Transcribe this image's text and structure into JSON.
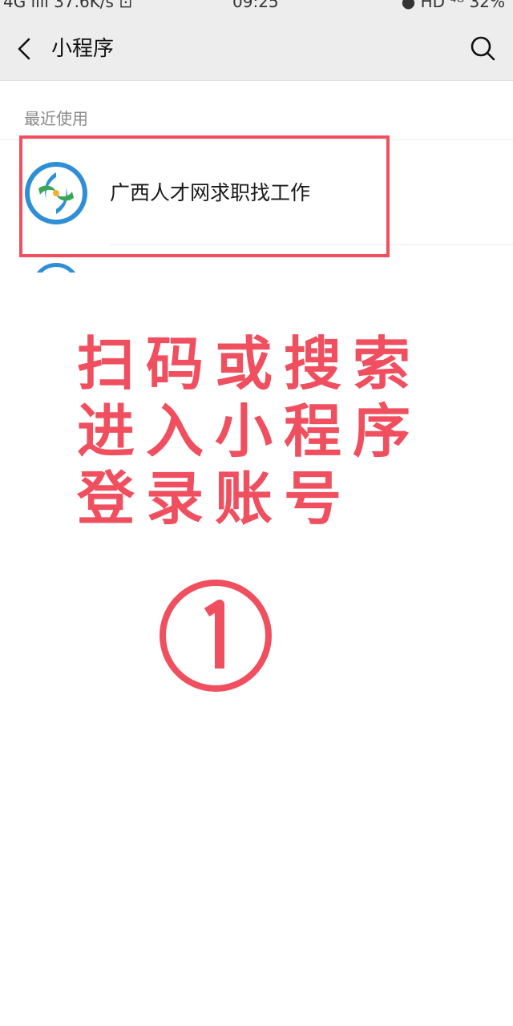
{
  "status_bar": {
    "left": "4G ıııl 37.6K/s ⊡",
    "time": "09:25",
    "right": "● HD ⁴ᴳ 32%"
  },
  "header": {
    "title": "小程序"
  },
  "recent_section": {
    "label": "最近使用"
  },
  "mini_programs": [
    {
      "name": "广西人才网求职找工作"
    }
  ],
  "annotation": {
    "lines": [
      "扫码或搜索",
      "进入小程序",
      "登录账号"
    ],
    "step": "①"
  },
  "colors": {
    "header_bg": "#ededed",
    "highlight": "#f04f5f",
    "icon_blue": "#2f8fd6",
    "icon_green": "#3aa655"
  }
}
